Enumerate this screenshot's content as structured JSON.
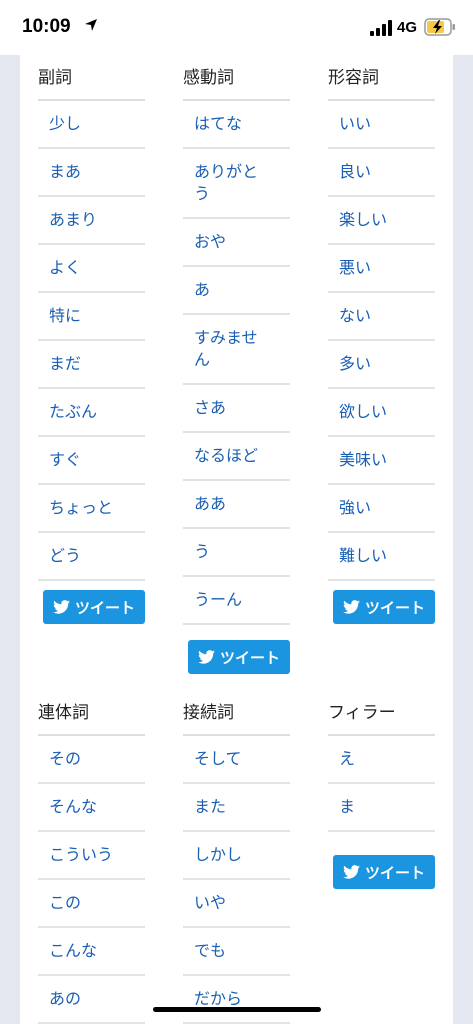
{
  "status_bar": {
    "time": "10:09",
    "network": "4G"
  },
  "sections": [
    {
      "title": "副詞",
      "items": [
        "少し",
        "まあ",
        "あまり",
        "よく",
        "特に",
        "まだ",
        "たぶん",
        "すぐ",
        "ちょっと",
        "どう"
      ]
    },
    {
      "title": "感動詞",
      "items": [
        "はてな",
        "ありがとう",
        "おや",
        "あ",
        "すみません",
        "さあ",
        "なるほど",
        "ああ",
        "う",
        "うーん"
      ]
    },
    {
      "title": "形容詞",
      "items": [
        "いい",
        "良い",
        "楽しい",
        "悪い",
        "ない",
        "多い",
        "欲しい",
        "美味い",
        "強い",
        "難しい"
      ]
    },
    {
      "title": "連体詞",
      "items": [
        "その",
        "そんな",
        "こういう",
        "この",
        "こんな",
        "あの"
      ]
    },
    {
      "title": "接続詞",
      "items": [
        "そして",
        "また",
        "しかし",
        "いや",
        "でも",
        "だから"
      ]
    },
    {
      "title": "フィラー",
      "items": [
        "え",
        "ま"
      ]
    }
  ],
  "tweet_label": "ツイート",
  "icons": {
    "tweet": "twitter-bird-icon",
    "location": "location-arrow-icon"
  },
  "colors": {
    "link": "#1a5fb4",
    "tweet_button": "#1b95e0",
    "page_background": "#e4e7ef"
  }
}
